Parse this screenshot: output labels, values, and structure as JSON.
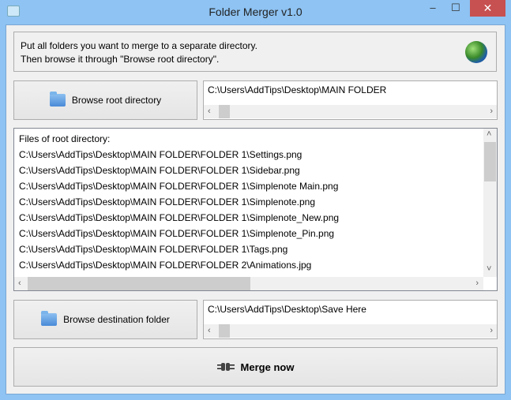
{
  "window": {
    "title": "Folder Merger v1.0",
    "minimize": "‒",
    "maximize": "☐",
    "close": "✕"
  },
  "info": {
    "line1": "Put all folders you want to merge to a separate directory.",
    "line2": "Then browse it through \"Browse root directory\"."
  },
  "root": {
    "button_label": "Browse root directory",
    "path": "C:\\Users\\AddTips\\Desktop\\MAIN FOLDER"
  },
  "files": {
    "header": "Files of root directory:",
    "items": [
      "C:\\Users\\AddTips\\Desktop\\MAIN FOLDER\\FOLDER 1\\Settings.png",
      "C:\\Users\\AddTips\\Desktop\\MAIN FOLDER\\FOLDER 1\\Sidebar.png",
      "C:\\Users\\AddTips\\Desktop\\MAIN FOLDER\\FOLDER 1\\Simplenote Main.png",
      "C:\\Users\\AddTips\\Desktop\\MAIN FOLDER\\FOLDER 1\\Simplenote.png",
      "C:\\Users\\AddTips\\Desktop\\MAIN FOLDER\\FOLDER 1\\Simplenote_New.png",
      "C:\\Users\\AddTips\\Desktop\\MAIN FOLDER\\FOLDER 1\\Simplenote_Pin.png",
      "C:\\Users\\AddTips\\Desktop\\MAIN FOLDER\\FOLDER 1\\Tags.png",
      "C:\\Users\\AddTips\\Desktop\\MAIN FOLDER\\FOLDER 2\\Animations.jpg"
    ]
  },
  "destination": {
    "button_label": "Browse destination folder",
    "path": "C:\\Users\\AddTips\\Desktop\\Save Here"
  },
  "merge": {
    "button_label": "Merge now"
  },
  "arrows": {
    "left": "‹",
    "right": "›",
    "up": "˄",
    "down": "˅"
  }
}
